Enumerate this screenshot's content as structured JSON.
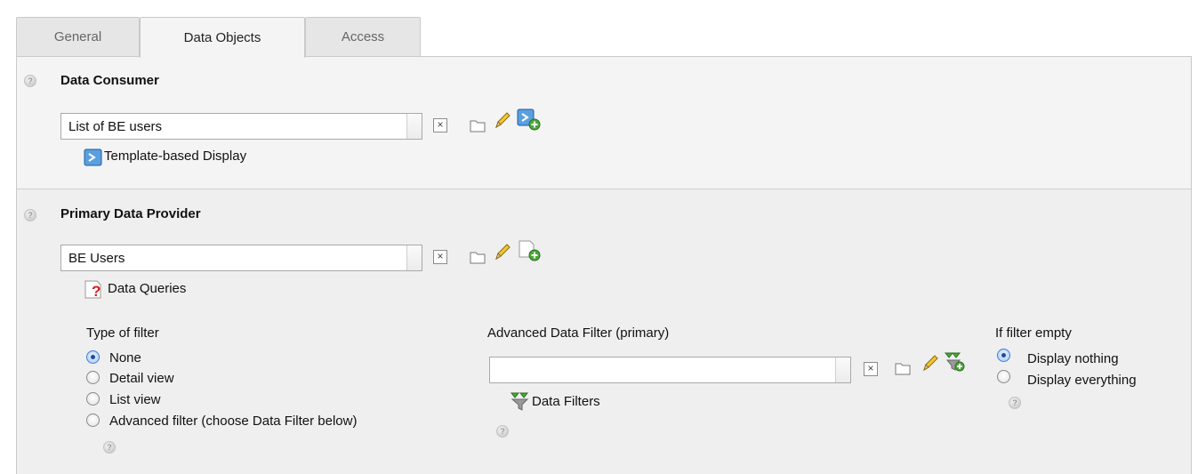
{
  "tabs": [
    {
      "label": "General"
    },
    {
      "label": "Data Objects",
      "active": true
    },
    {
      "label": "Access"
    }
  ],
  "consumer": {
    "title": "Data Consumer",
    "value": "List of BE users",
    "link_label": "Template-based Display",
    "clear_glyph": "×"
  },
  "provider": {
    "title": "Primary Data Provider",
    "value": "BE Users",
    "link_label": "Data Queries",
    "clear_glyph": "×"
  },
  "filter_type": {
    "label": "Type of filter",
    "options": [
      "None",
      "Detail view",
      "List view",
      "Advanced filter (choose Data Filter below)"
    ],
    "selected": "None"
  },
  "advanced_filter": {
    "label": "Advanced Data Filter (primary)",
    "value": "",
    "link_label": "Data Filters",
    "clear_glyph": "×"
  },
  "if_empty": {
    "label": "If filter empty",
    "options": [
      "Display nothing",
      "Display everything"
    ],
    "selected": "Display nothing"
  },
  "icons": {
    "help": "help-icon",
    "folder": "folder-icon",
    "edit": "pencil-icon",
    "add_consumer": "add-template-display-icon",
    "add_provider": "add-data-query-icon",
    "add_filter": "add-data-filter-icon"
  },
  "colors": {
    "radio_selected": "#1e4f94",
    "panel": "#f1f1f1"
  }
}
